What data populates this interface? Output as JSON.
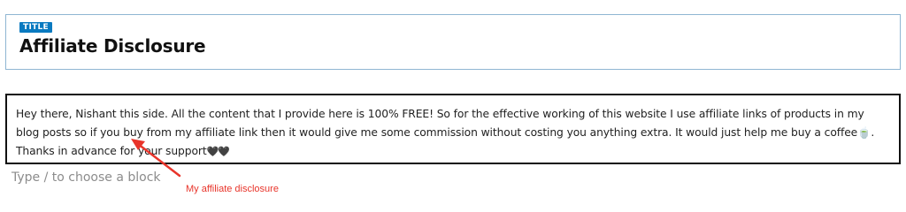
{
  "title_block": {
    "badge": "TITLE",
    "heading": "Affiliate Disclosure"
  },
  "paragraph": {
    "text_main": "Hey there, Nishant this side. All the content that I provide here is 100% FREE! So for the effective working of this website I use affiliate links of products in my blog posts so if you buy from my affiliate link then it would give me some commission without costing you anything extra. It would just help me buy a coffee",
    "coffee_emoji": "🍵",
    "text_tail": ". Thanks in advance for your support",
    "hearts": "🖤🖤"
  },
  "editor": {
    "placeholder": "Type / to choose a block"
  },
  "annotation": {
    "label": "My affiliate disclosure",
    "color": "#e8342a"
  },
  "colors": {
    "badge_bg": "#0a7ac0",
    "title_border": "#8fb6d3"
  }
}
